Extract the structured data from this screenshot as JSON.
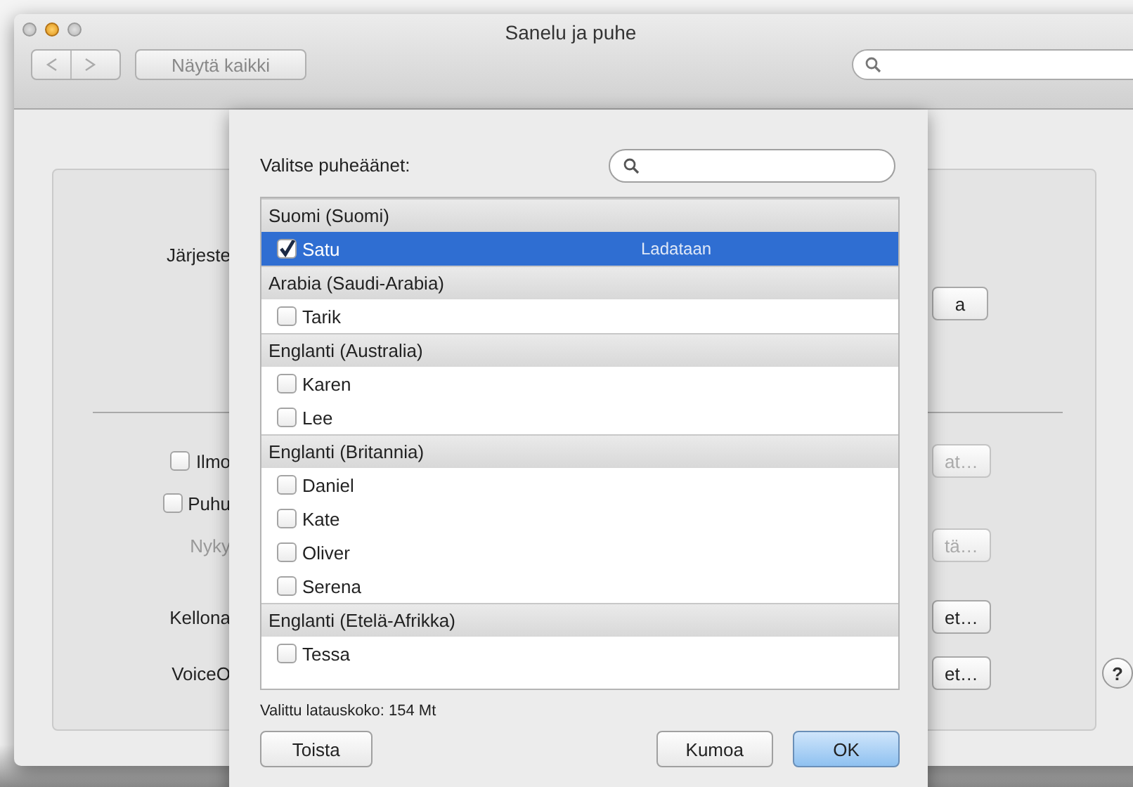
{
  "window": {
    "title": "Sanelu ja puhe",
    "show_all_button": "Näytä kaikki"
  },
  "settings_panel": {
    "upper": [
      {
        "kind": "label",
        "text": "Järjeste",
        "disabled": false
      },
      {
        "kind": "button_only",
        "button": "a",
        "button_disabled": false
      }
    ],
    "lower": [
      {
        "kind": "checkbox",
        "text": "Ilmo",
        "checked": false,
        "disabled": false,
        "button": "at…",
        "button_disabled": true
      },
      {
        "kind": "checkbox",
        "text": "Puhu",
        "checked": false,
        "disabled": false
      },
      {
        "kind": "label",
        "text": "Nyky",
        "disabled": true,
        "button": "tä…",
        "button_disabled": true
      },
      {
        "kind": "label",
        "text": "Kellona",
        "disabled": false,
        "button": "et…",
        "button_disabled": false
      },
      {
        "kind": "label",
        "text": "VoiceO",
        "disabled": false,
        "button": "et…",
        "button_disabled": false,
        "help": "?"
      }
    ]
  },
  "sheet": {
    "prompt": "Valitse puheäänet:",
    "groups": [
      {
        "name": "Suomi (Suomi)",
        "voices": [
          {
            "name": "Satu",
            "checked": true,
            "selected": true,
            "status": "Ladataan"
          }
        ]
      },
      {
        "name": "Arabia (Saudi-Arabia)",
        "voices": [
          {
            "name": "Tarik",
            "checked": false,
            "selected": false
          }
        ]
      },
      {
        "name": "Englanti (Australia)",
        "voices": [
          {
            "name": "Karen",
            "checked": false,
            "selected": false
          },
          {
            "name": "Lee",
            "checked": false,
            "selected": false
          }
        ]
      },
      {
        "name": "Englanti (Britannia)",
        "voices": [
          {
            "name": "Daniel",
            "checked": false,
            "selected": false
          },
          {
            "name": "Kate",
            "checked": false,
            "selected": false
          },
          {
            "name": "Oliver",
            "checked": false,
            "selected": false
          },
          {
            "name": "Serena",
            "checked": false,
            "selected": false
          }
        ]
      },
      {
        "name": "Englanti (Etelä-Afrikka)",
        "voices": [
          {
            "name": "Tessa",
            "checked": false,
            "selected": false
          }
        ]
      }
    ],
    "download_size": "Valittu latauskoko: 154 Mt",
    "buttons": [
      {
        "kind": "play",
        "label": "Toista"
      },
      {
        "kind": "cancel",
        "label": "Kumoa"
      },
      {
        "kind": "default",
        "label": "OK"
      }
    ]
  }
}
